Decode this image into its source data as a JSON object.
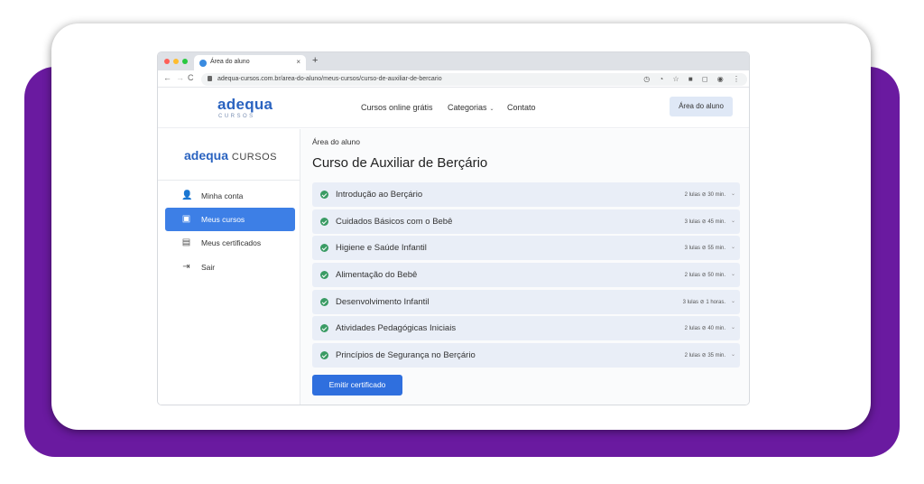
{
  "browser": {
    "tab_title": "Área do aluno",
    "tab_close": "×",
    "new_tab": "+",
    "url": "adequa-cursos.com.br/area-do-aluno/meus-cursos/curso-de-auxiliar-de-bercario",
    "nav": {
      "back": "←",
      "forward": "→",
      "reload": "C"
    },
    "omni_icons": "◷ ◔ ☆ ■ ◻ ◉ ⋮"
  },
  "header": {
    "logo_main": "adequa",
    "logo_sub": "CURSOS",
    "nav": [
      "Cursos online grátis",
      "Categorias",
      "Contato"
    ],
    "nav_chevron": "⌄",
    "cta": "Área do aluno"
  },
  "sidebar": {
    "logo_bold": "adequa",
    "logo_light": "CURSOS",
    "items": [
      {
        "label": "Minha conta",
        "icon": "user-icon",
        "glyph": "👤",
        "active": false
      },
      {
        "label": "Meus cursos",
        "icon": "courses-icon",
        "glyph": "▣",
        "active": true
      },
      {
        "label": "Meus certificados",
        "icon": "certificate-icon",
        "glyph": "▤",
        "active": false
      },
      {
        "label": "Sair",
        "icon": "logout-icon",
        "glyph": "⇥",
        "active": false
      }
    ]
  },
  "main": {
    "breadcrumb": "Área do aluno",
    "title": "Curso de Auxiliar de Berçário",
    "modules": [
      {
        "title": "Introdução ao Berçário",
        "meta": "2 lulas ⊘ 30 min.",
        "chevron": "⌄"
      },
      {
        "title": "Cuidados Básicos com o Bebê",
        "meta": "3 lulas ⊘ 45 min.",
        "chevron": "⌄"
      },
      {
        "title": "Higiene e Saúde Infantil",
        "meta": "3 lulas ⊘ 55 min.",
        "chevron": "⌄"
      },
      {
        "title": "Alimentação do Bebê",
        "meta": "2 lulas ⊘ 50 min.",
        "chevron": "⌄"
      },
      {
        "title": "Desenvolvimento Infantil",
        "meta": "3 lulas ⊘ 1 horas.",
        "chevron": "⌄"
      },
      {
        "title": "Atividades Pedagógicas Iniciais",
        "meta": "2 lulas ⊘ 40 min.",
        "chevron": "⌄"
      },
      {
        "title": "Princípios de Segurança no Berçário",
        "meta": "2 lulas ⊘ 35 min.",
        "chevron": "⌄"
      }
    ],
    "cert_button": "Emitir certificado"
  },
  "colors": {
    "frame": "#6a1aa0",
    "accent": "#3d7fe6",
    "check": "#3a9b64",
    "module_bg": "#e9eef7"
  }
}
